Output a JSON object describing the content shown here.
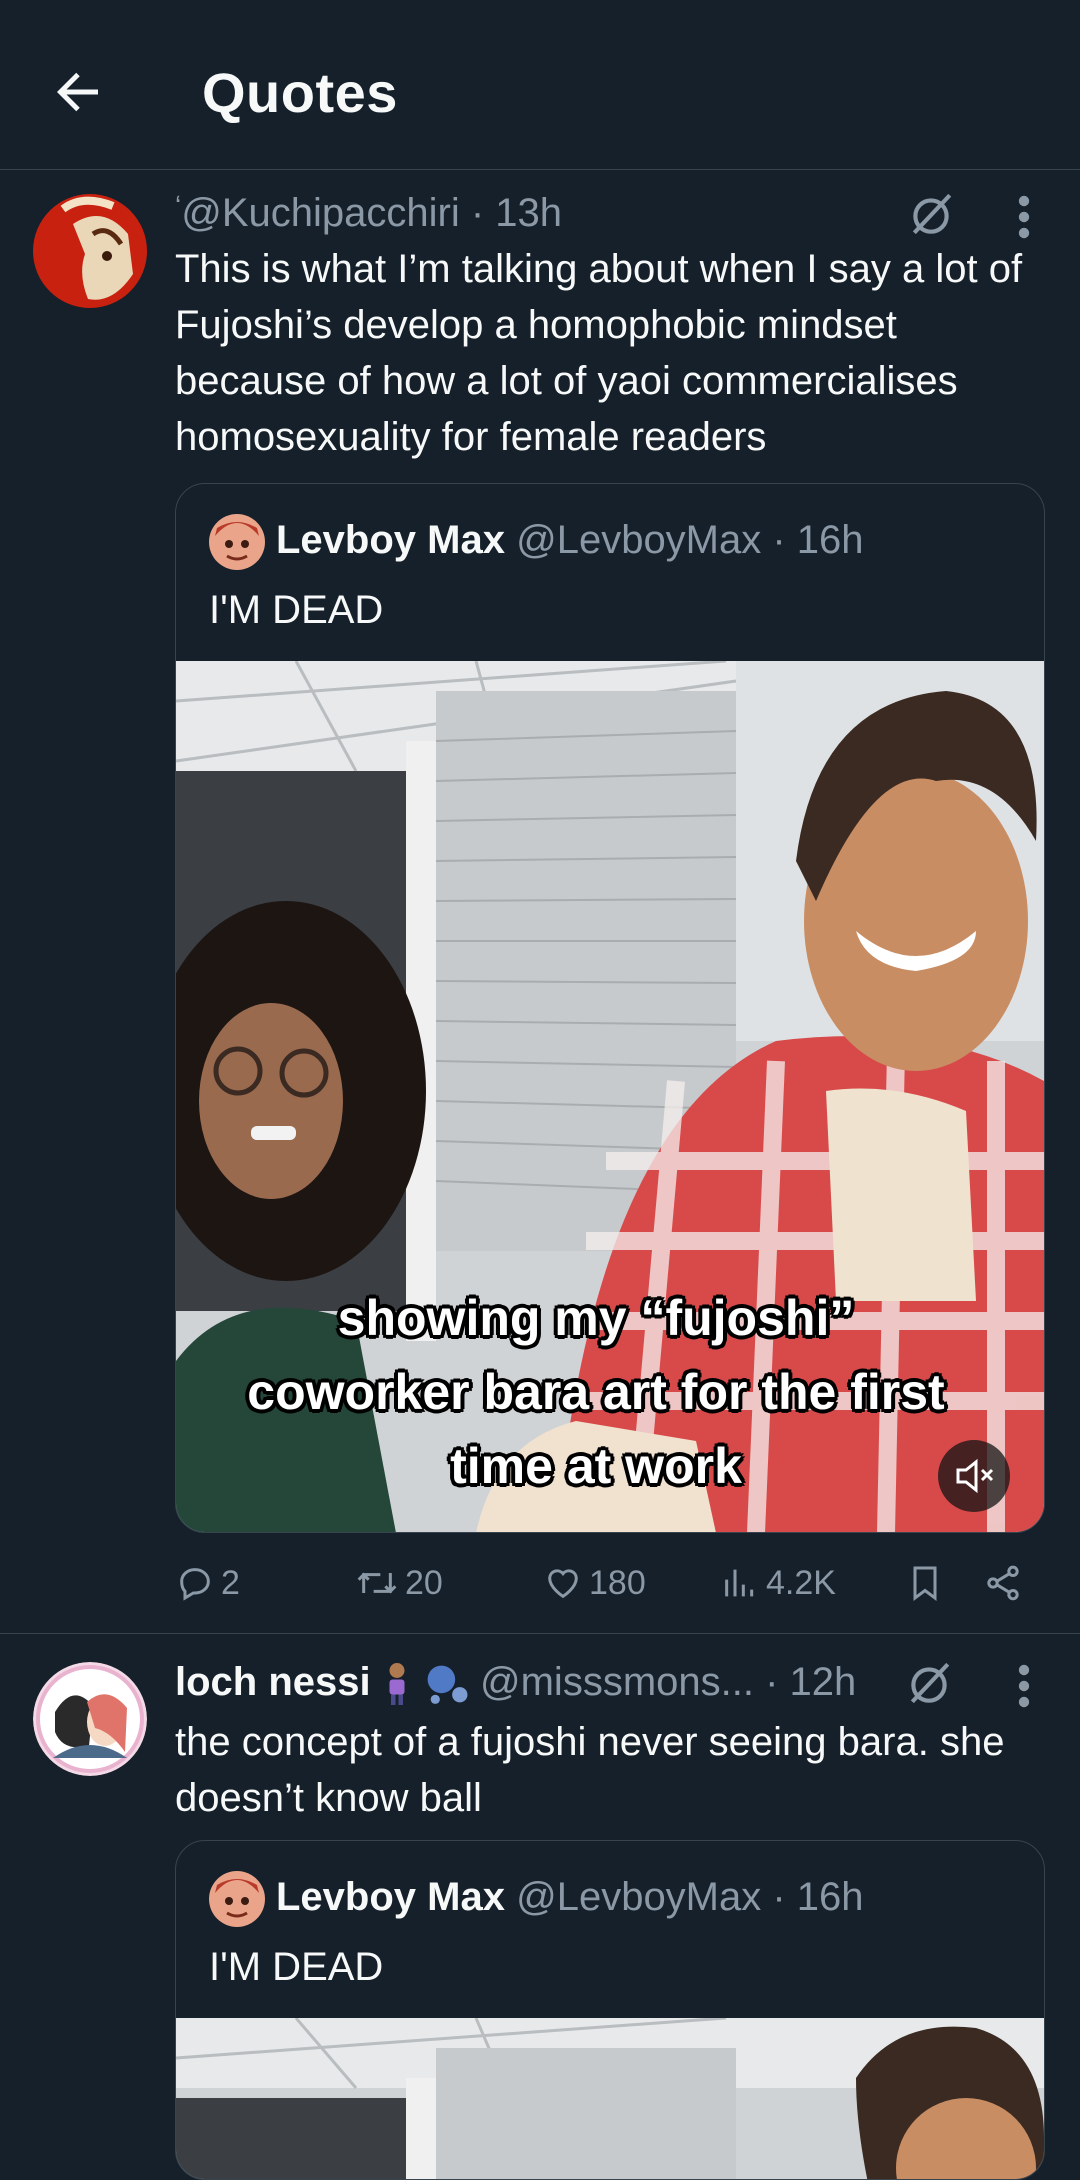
{
  "header": {
    "title": "Quotes"
  },
  "posts": [
    {
      "handle": "@Kuchipacchiri",
      "time": "13h",
      "text": "This is what I’m talking about when I say a lot of Fujoshi’s develop a homophobic mindset because of how a lot of yaoi commercialises homosexuality for female readers",
      "quote": {
        "name": "Levboy Max",
        "handle": "@LevboyMax",
        "time": "16h",
        "text": "I'M DEAD",
        "video_caption": "showing my “fujoshi” coworker bara art for the first time at work"
      },
      "actions": {
        "replies": "2",
        "reposts": "20",
        "likes": "180",
        "views": "4.2K"
      }
    },
    {
      "name": "loch nessi",
      "handle": "@misssmons...",
      "time": "12h",
      "text": "the concept of a fujoshi never seeing bara. she doesn’t know ball",
      "quote": {
        "name": "Levboy Max",
        "handle": "@LevboyMax",
        "time": "16h",
        "text": "I'M DEAD"
      }
    }
  ],
  "colors": {
    "background": "#15202b",
    "muted": "#8b98a5",
    "border": "#38444d"
  }
}
